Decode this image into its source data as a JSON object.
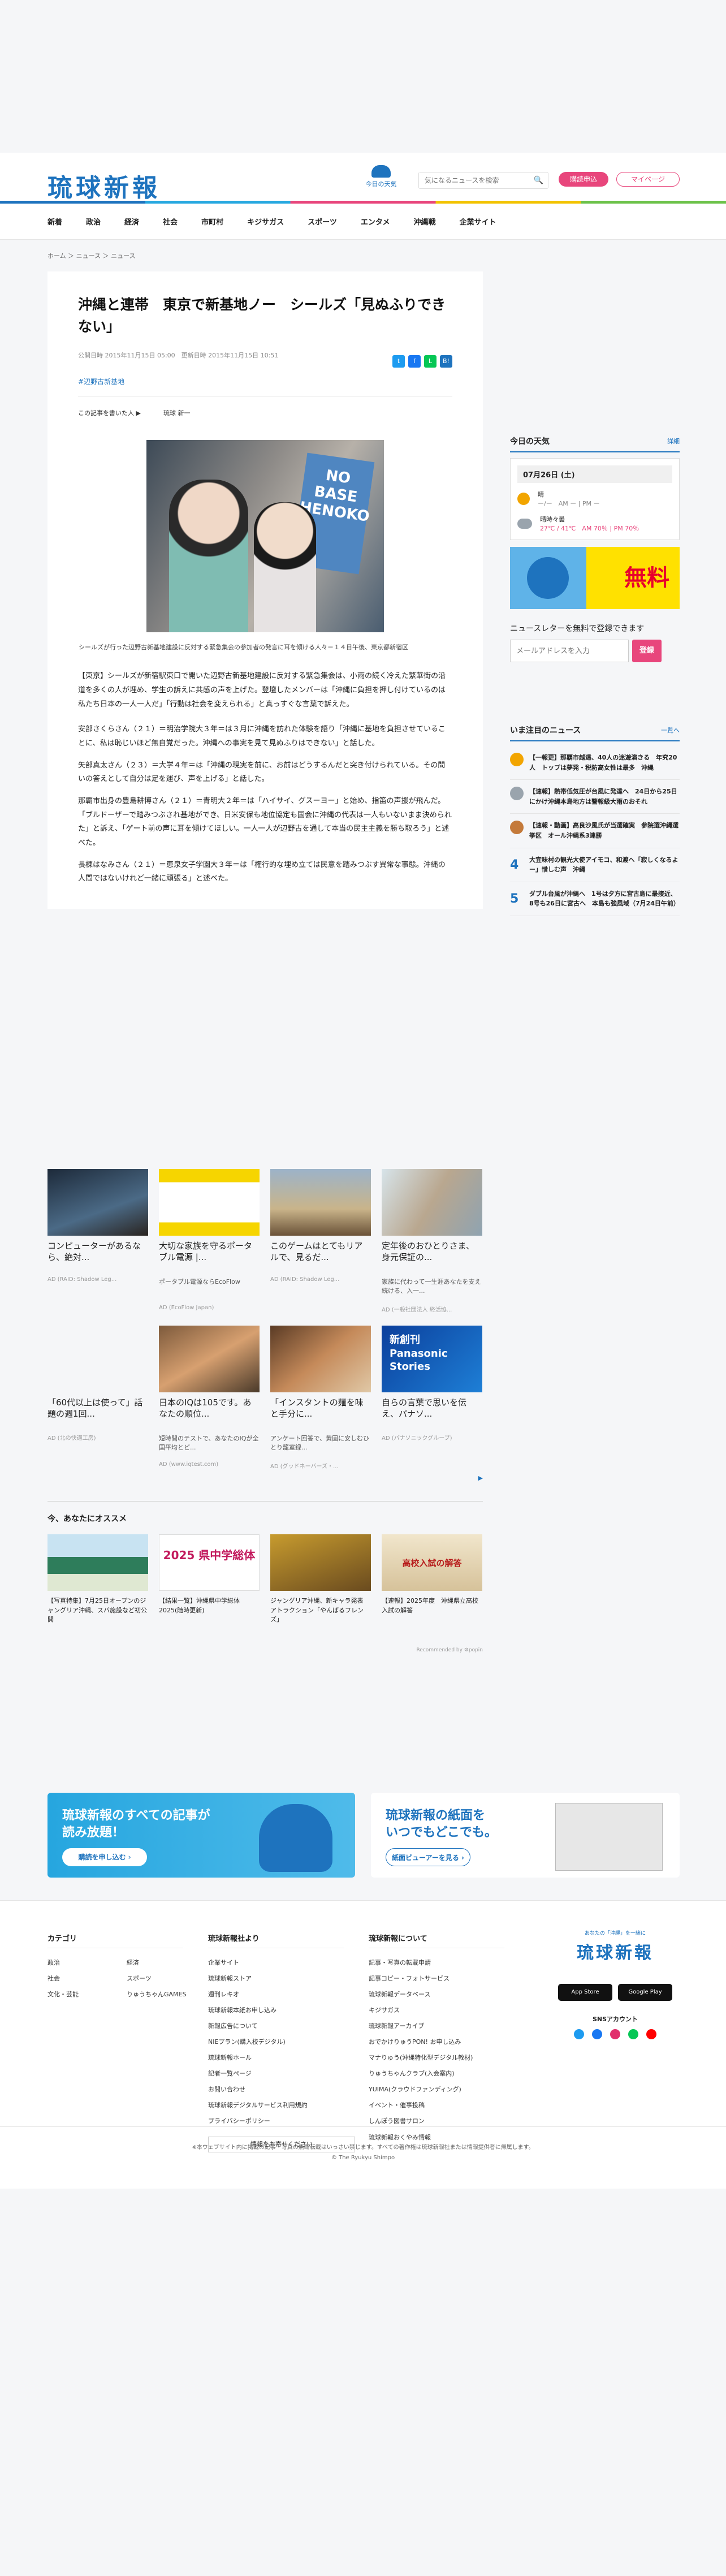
{
  "header": {
    "logo": "琉球新報",
    "weather_label": "今日の天気",
    "search_placeholder": "気になるニュースを検索",
    "subscribe": "購読申込",
    "mypage": "マイページ"
  },
  "nav": [
    "新着",
    "政治",
    "経済",
    "社会",
    "市町村",
    "キジサガス",
    "スポーツ",
    "エンタメ",
    "沖縄戦",
    "企業サイト"
  ],
  "breadcrumb": "ホーム ＞ ニュース ＞ ニュース",
  "article": {
    "title": "沖縄と連帯　東京で新基地ノー　シールズ「見ぬふりできない」",
    "dates": "公開日時 2015年11月15日 05:00　更新日時 2015年11月15日 10:51",
    "tag": "#辺野古新基地",
    "byline_note": "この記事を書いた人 ▶",
    "author": "琉球 新一",
    "photo_sign": "NO BASE HENOKO",
    "caption": "シールズが行った辺野古新基地建設に反対する緊急集会の参加者の発言に耳を傾ける人々＝１４日午後、東京都新宿区",
    "paragraphs": [
      "【東京】シールズが新宿駅東口で開いた辺野古新基地建設に反対する緊急集会は、小雨の続く冷えた繁華街の沿道を多くの人が埋め、学生の訴えに共感の声を上げた。登壇したメンバーは「沖縄に負担を押し付けているのは私たち日本の一人一人だ」「行動は社会を変えられる」と真っすぐな言葉で訴えた。",
      "安部さくらさん（２１）＝明治学院大３年＝は３月に沖縄を訪れた体験を語り「沖縄に基地を負担させていることに、私は恥じいほど無自覚だった。沖縄への事実を見て見ぬふりはできない」と話した。",
      "矢部真太さん（２３）＝大学４年＝は「沖縄の現実を前に、お前はどうするんだと突き付けられている。その問いの答えとして自分は足を運び、声を上げる」と話した。",
      "那覇市出身の豊島耕博さん（２１）＝青明大２年＝は「ハイサイ、グスーヨー」と始め、指笛の声援が飛んだ。「ブルドーザーで踏みつぶされ基地ができ、日米安保も地位協定も国会に沖縄の代表は一人もいないまま決められた」と訴え、「ゲート前の声に耳を傾けてほしい。一人一人が辺野古を通して本当の民主主義を勝ち取ろう」と述べた。",
      "長棟はなみさん（２１）＝恵泉女子学園大３年＝は「権行的な埋め立ては民意を踏みつぶす異常な事態。沖縄の人間ではないけれど一緒に頑張る」と述べた。"
    ]
  },
  "ads": {
    "cards": [
      {
        "title": "コンピューターがあるなら、絶対...",
        "sub": "",
        "src": "AD (RAID: Shadow Leg..."
      },
      {
        "title": "大切な家族を守るポータブル電源 |...",
        "sub": "ポータブル電源ならEcoFlow",
        "src": "AD (EcoFlow Japan)"
      },
      {
        "title": "このゲームはとてもリアルで、見るだ...",
        "sub": "",
        "src": "AD (RAID: Shadow Leg..."
      },
      {
        "title": "定年後のおひとりさま、身元保証の...",
        "sub": "家族に代わって一生涯あなたを支え続ける、入一...",
        "src": "AD (一般社団法人 終活協..."
      },
      {
        "title": "「60代以上は使って」話題の週1回...",
        "sub": "",
        "src": "AD (北の快適工房)"
      },
      {
        "title": "日本のIQは105です。あなたの順位...",
        "sub": "短時間のテストで、あなたのIQが全国平均とど...",
        "src": "AD (www.iqtest.com)"
      },
      {
        "title": "「インスタントの麺を味と手分に...",
        "sub": "アンケート回答で、黄固に安しむひとり籠室録...",
        "src": "AD (グッドネーバーズ・..."
      },
      {
        "title": "自らの言葉で思いを伝え、パナソ...",
        "sub": "",
        "src": "AD (パナソニックグループ)"
      }
    ],
    "card7_overlay": "新創刊 Panasonic Stories",
    "osusume_title": "今、あなたにオススメ",
    "recs": [
      "【写真特集】7月25日オープンのジャングリア沖縄、スバ施設など初公開",
      "【結果一覧】沖縄県中学総体2025(随時更新)",
      "ジャングリア沖縄、新キャラ発表　アトラクション「やんばるフレンズ」",
      "【速報】2025年度　沖縄県立高校入試の解答"
    ],
    "rec2_overlay": "2025 県中学総体",
    "rec4_overlay": "高校入試の解答",
    "powered": "Recommended by ⚙popin"
  },
  "side": {
    "weather_title": "今日の天気",
    "weather_more": "詳細",
    "weather_date": "07月26日 (土)",
    "weather_line1": "晴",
    "weather_line1b": "ー/ー　AM ー | PM ー",
    "weather_line2": "晴時々曇",
    "weather_temp": "27℃ / 41℃　AM 70％ | PM 70％",
    "banner_text": "無料",
    "newsletter_title": "ニュースレターを無料で登録できます",
    "newsletter_placeholder": "メールアドレスを入力",
    "newsletter_btn": "登録",
    "ranking_title": "いま注目のニュース",
    "ranking_more": "一覧へ",
    "ranking": [
      {
        "n": "",
        "t": "【一報更】那覇市越遠、40人の迷遊演きる　年究20人　トップは夢発・税防高女性は最多　沖縄"
      },
      {
        "n": "",
        "t": "【速報】熱帯低気圧が台風に発達へ　24日から25日にかけ沖縄本島地方は警報級大雨のおそれ"
      },
      {
        "n": "",
        "t": "【速報・動画】高良沙風氏が当選確実　参院選沖縄選挙区　オール沖縄系3連勝"
      },
      {
        "n": "4",
        "t": "大宜味村の観光大使アイモコ、和渡へ「寂しくなるよー」惜しむ声　沖縄"
      },
      {
        "n": "5",
        "t": "ダブル台風が沖縄へ　1号は夕方に宮古島に最接近、8号も26日に宮古へ　本島も強風域（7月24日午前）"
      }
    ]
  },
  "promo": {
    "a_title": "琉球新報のすべての記事が\n読み放題！",
    "a_btn": "購読を申し込む ›",
    "b_title": "琉球新報の紙面を\nいつでもどこでも。",
    "b_btn": "紙面ビューアーを見る ›"
  },
  "footer": {
    "cat_title": "カテゴリ",
    "cat_items": [
      "政治",
      "経済",
      "社会",
      "スポーツ",
      "文化・芸能",
      "りゅうちゃんGAMES"
    ],
    "about_title": "琉球新報社より",
    "about_items": [
      "企業サイト",
      "琉球新報ストア",
      "週刊レキオ",
      "琉球新報本紙お申し込み",
      "新報広告について",
      "NIEプラン(購入校デジタル)",
      "琉球新報ホール",
      "記者一覧ページ",
      "お問い合わせ",
      "琉球新報デジタルサービス利用規約",
      "プライバシーポリシー"
    ],
    "info_btn": "情報をお寄せください",
    "svc_title": "琉球新報について",
    "svc_items": [
      "記事・写真の転載申請",
      "記事コピー・フォトサービス",
      "琉球新報データベース",
      "キジサガス",
      "琉球新報アーカイブ",
      "おでかけりゅうPON! お申し込み",
      "マナりゅう(沖縄特化型デジタル教材)",
      "りゅうちゃんクラブ(入会案内)",
      "YUIMA(クラウドファンディング)",
      "イベント・催事投稿",
      "しんぽう図書サロン",
      "琉球新報おくやみ情報"
    ],
    "tagline": "あなたの「沖縄」を一緒に",
    "logo": "琉球新報",
    "app_store": "App Store",
    "google_play": "Google Play",
    "sns_title": "SNSアカウント",
    "copyright1": "※本ウェブサイト内に掲載の記事・写真の無断転載はいっさい禁じます。すべての著作権は琉球新報社または情報提供者に帰属します。",
    "copyright2": "© The Ryukyu Shimpo"
  },
  "colors": {
    "brand": "#1e73be",
    "accent": "#e8467c"
  }
}
